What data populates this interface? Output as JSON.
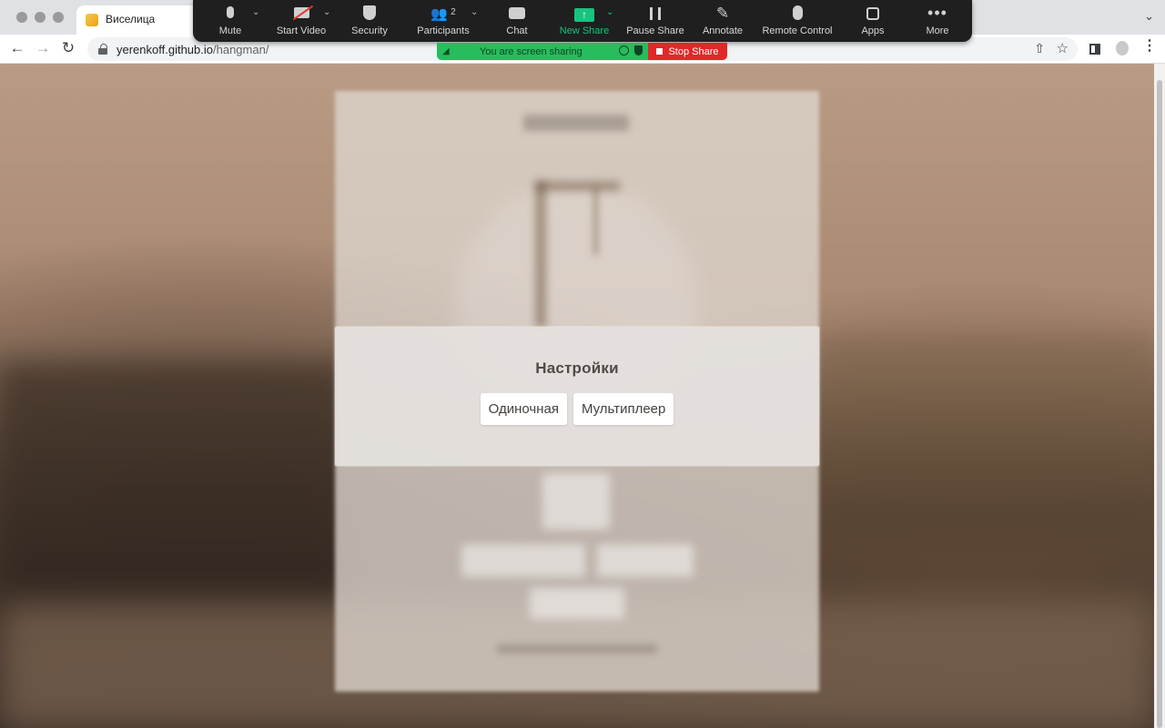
{
  "browser": {
    "tab_title": "Виселица",
    "url_host": "yerenkoff.github.io",
    "url_path": "/hangman/"
  },
  "icons": {
    "back": "←",
    "forward": "→",
    "reload": "↻",
    "share": "⇧",
    "star": "☆",
    "tab_menu": "⌄",
    "zoom_participants": "👥",
    "zoom_more": "•••",
    "caret": "⌄"
  },
  "zoom": {
    "items": [
      {
        "id": "mute",
        "label": "Mute"
      },
      {
        "id": "start_video",
        "label": "Start Video"
      },
      {
        "id": "security",
        "label": "Security"
      },
      {
        "id": "participants",
        "label": "Participants",
        "count": "2"
      },
      {
        "id": "chat",
        "label": "Chat"
      },
      {
        "id": "new_share",
        "label": "New Share"
      },
      {
        "id": "pause_share",
        "label": "Pause Share"
      },
      {
        "id": "annotate",
        "label": "Annotate"
      },
      {
        "id": "remote_control",
        "label": "Remote Control"
      },
      {
        "id": "apps",
        "label": "Apps"
      },
      {
        "id": "more",
        "label": "More"
      }
    ],
    "sharing_banner": "You are screen sharing",
    "stop_share": "Stop Share"
  },
  "modal": {
    "title": "Настройки",
    "buttons": [
      "Одиночная",
      "Мультиплеер"
    ]
  },
  "colors": {
    "zoom_green": "#19c37d",
    "banner_green": "#27bc5c",
    "stop_red": "#e02828",
    "video_off_red": "#e0372e"
  }
}
